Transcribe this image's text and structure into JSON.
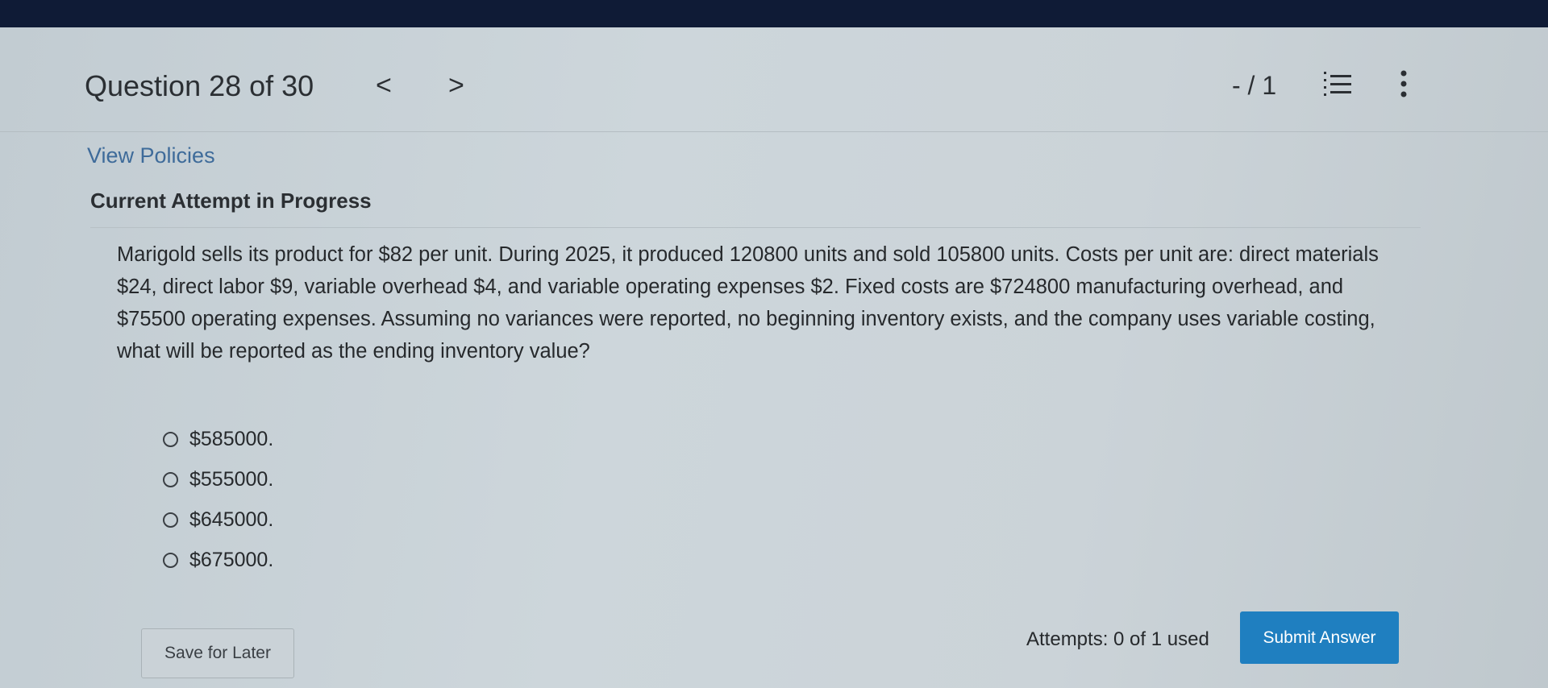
{
  "header": {
    "question_title": "Question 28 of 30",
    "prev_glyph": "<",
    "next_glyph": ">",
    "score": "- / 1",
    "list_icon": "list-icon",
    "more_icon": "more-vertical-icon"
  },
  "links": {
    "view_policies": "View Policies"
  },
  "attempt_heading": "Current Attempt in Progress",
  "question_text": "Marigold sells its product for $82 per unit. During 2025, it produced 120800 units and sold 105800 units. Costs per unit are: direct materials $24, direct labor $9, variable overhead $4, and variable operating expenses $2. Fixed costs are $724800 manufacturing overhead, and $75500 operating expenses. Assuming no variances were reported, no beginning inventory exists, and the company uses variable costing, what will be reported as the ending inventory value?",
  "options": [
    {
      "label": "$585000."
    },
    {
      "label": "$555000."
    },
    {
      "label": "$645000."
    },
    {
      "label": "$675000."
    }
  ],
  "footer": {
    "save_label": "Save for Later",
    "attempts": "Attempts: 0 of 1 used",
    "submit_label": "Submit Answer"
  },
  "colors": {
    "accent": "#1f7fc0",
    "link": "#3e6b9a",
    "top_bar": "#0f1b36"
  }
}
